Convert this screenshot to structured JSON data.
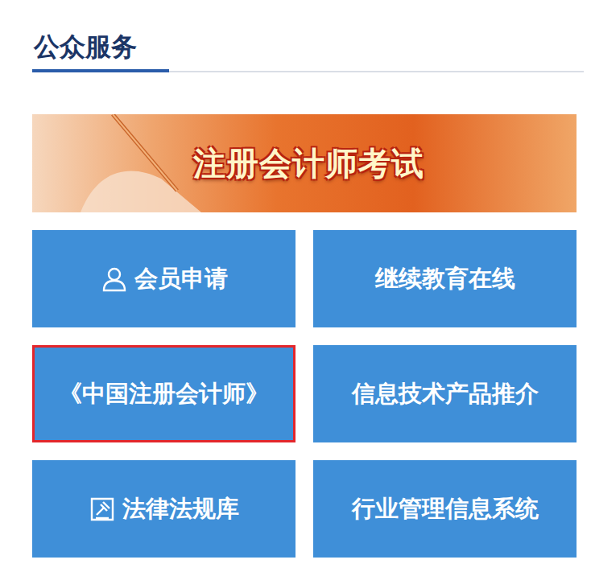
{
  "section": {
    "title": "公众服务"
  },
  "banner": {
    "label": "注册会计师考试"
  },
  "tiles": [
    {
      "label": "会员申请",
      "kind": "person",
      "highlighted": false
    },
    {
      "label": "继续教育在线",
      "kind": "plain",
      "highlighted": false
    },
    {
      "label": "《中国注册会计师》",
      "kind": "plain",
      "highlighted": true
    },
    {
      "label": "信息技术产品推介",
      "kind": "plain",
      "highlighted": false
    },
    {
      "label": "法律法规库",
      "kind": "law",
      "highlighted": false
    },
    {
      "label": "行业管理信息系统",
      "kind": "plain",
      "highlighted": false
    }
  ]
}
